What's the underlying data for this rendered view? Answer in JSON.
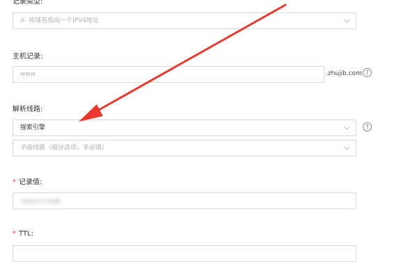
{
  "record_type": {
    "label": "记录类型:",
    "value": "A- 将域名指向一个IPV4地址"
  },
  "host": {
    "label": "主机记录:",
    "value": "www",
    "suffix": ".zhujib.com"
  },
  "line": {
    "label": "解析线路:",
    "value": "搜索引擎",
    "sub_placeholder": "子级线路（细分选项，非必填）"
  },
  "record_value": {
    "required_mark": "*",
    "label": "记录值:",
    "value": ":"
  },
  "ttl": {
    "required_mark": "*",
    "label": "TTL:"
  },
  "help_glyph": "?",
  "colors": {
    "arrow": "#e8382f",
    "required": "#e23c39",
    "border": "#d9d9d9"
  },
  "icons": [
    "chevron-down-icon",
    "help-icon",
    "arrow-annotation"
  ]
}
